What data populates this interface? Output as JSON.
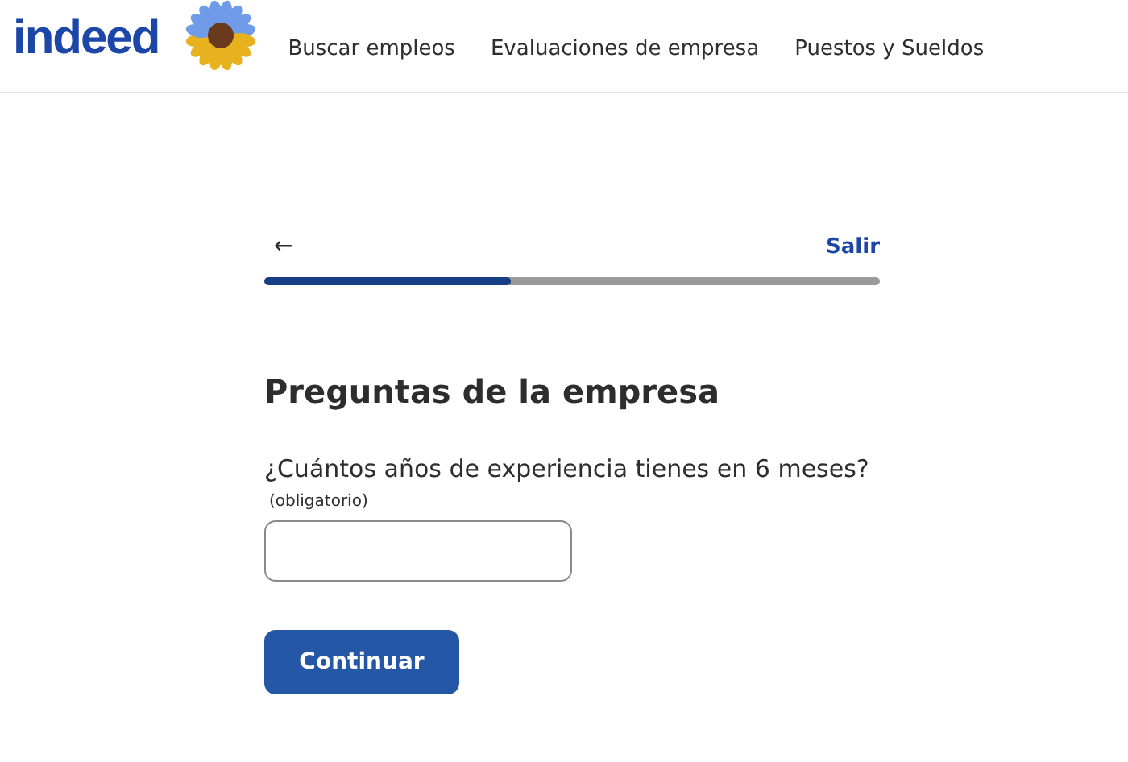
{
  "header": {
    "logo": "indeed",
    "nav": [
      {
        "label": "Buscar empleos"
      },
      {
        "label": "Evaluaciones de empresa"
      },
      {
        "label": "Puestos y Sueldos"
      }
    ]
  },
  "progress": {
    "back": "←",
    "exit": "Salir",
    "level": 0.4
  },
  "heading": "Preguntas de la empresa",
  "question": {
    "label": "¿Cuántos años de experiencia tienes en 6 meses?",
    "note": "(obligatorio)"
  },
  "button": "Continuar"
}
